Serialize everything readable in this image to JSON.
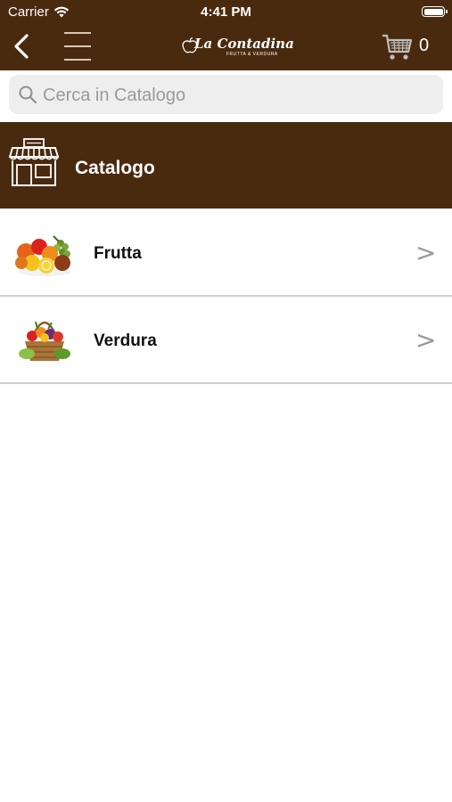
{
  "status_bar": {
    "carrier": "Carrier",
    "time": "4:41 PM"
  },
  "nav": {
    "logo_text": "La Contadina",
    "logo_tagline": "FRUTTA & VERDURA",
    "cart_count": "0"
  },
  "search": {
    "placeholder": "Cerca in Catalogo"
  },
  "section": {
    "title": "Catalogo"
  },
  "categories": [
    {
      "label": "Frutta",
      "icon": "fruit-basket-icon"
    },
    {
      "label": "Verdura",
      "icon": "vegetable-basket-icon"
    }
  ],
  "colors": {
    "brand_brown": "#4a2a0f",
    "search_bg": "#eeeeef",
    "chevron": "#9a9a9a"
  }
}
